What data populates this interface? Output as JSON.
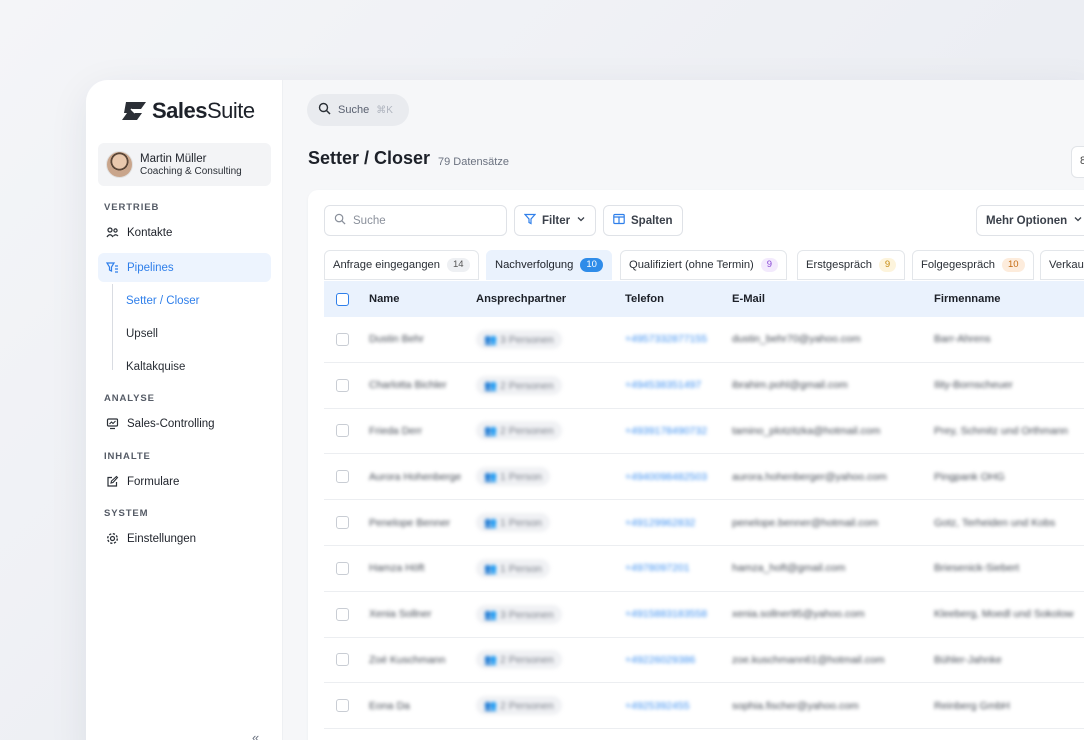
{
  "brand": {
    "bold": "Sales",
    "light": "Suite"
  },
  "user": {
    "name": "Martin Müller",
    "company": "Coaching & Consulting"
  },
  "nav": {
    "section_vertrieb": "VERTRIEB",
    "kontakte": "Kontakte",
    "pipelines": "Pipelines",
    "sub_items": [
      "Setter / Closer",
      "Upsell",
      "Kaltakquise"
    ],
    "section_analyse": "ANALYSE",
    "controlling": "Sales-Controlling",
    "section_inhalte": "INHALTE",
    "formulare": "Formulare",
    "section_system": "SYSTEM",
    "einstellungen": "Einstellungen",
    "collapse": "«"
  },
  "topbar": {
    "search_label": "Suche",
    "search_shortcut": "⌘K"
  },
  "page": {
    "title": "Setter / Closer",
    "count": "79 Datensätze",
    "corner_label": "8"
  },
  "toolbar": {
    "search_placeholder": "Suche",
    "filter": "Filter",
    "columns": "Spalten",
    "more": "Mehr Optionen"
  },
  "tabs": [
    {
      "label": "Anfrage eingegangen",
      "count": "14",
      "style": "gray"
    },
    {
      "label": "Nachverfolgung",
      "count": "10",
      "style": "blue"
    },
    {
      "label": "Qualifiziert (ohne Termin)",
      "count": "9",
      "style": "purple"
    },
    {
      "label": "Erstgespräch",
      "count": "9",
      "style": "yellow"
    },
    {
      "label": "Folgegespräch",
      "count": "10",
      "style": "orange"
    },
    {
      "label": "Verkau",
      "count": "",
      "style": "gray"
    }
  ],
  "table": {
    "headers": {
      "name": "Name",
      "contact": "Ansprechpartner",
      "phone": "Telefon",
      "email": "E-Mail",
      "company": "Firmenname"
    },
    "rows": [
      {
        "name": "Dustin Behr",
        "contact": "3 Personen",
        "phone": "+4957332877155",
        "email": "dustin_behr70@yahoo.com",
        "company": "Barr-Ahrens"
      },
      {
        "name": "Charlotta Bichler",
        "contact": "2 Personen",
        "phone": "+494538351497",
        "email": "ibrahim.pohl@gmail.com",
        "company": "Ility-Bornscheuer"
      },
      {
        "name": "Frieda Derr",
        "contact": "2 Personen",
        "phone": "+4939178490732",
        "email": "tamino_plotzitzka@hotmail.com",
        "company": "Prey, Schmitz und Orthmann"
      },
      {
        "name": "Aurora Hohenberge",
        "contact": "1 Person",
        "phone": "+4940098482503",
        "email": "aurora.hohenberger@yahoo.com",
        "company": "Pingpank OHG"
      },
      {
        "name": "Penelope Benner",
        "contact": "1 Person",
        "phone": "+49129962832",
        "email": "penelope.benner@hotmail.com",
        "company": "Gotz, Terheiden und Kobs"
      },
      {
        "name": "Hamza Höft",
        "contact": "1 Person",
        "phone": "+4978097201",
        "email": "hamza_hoft@gmail.com",
        "company": "Briesenick-Siebert"
      },
      {
        "name": "Xenia Sollner",
        "contact": "3 Personen",
        "phone": "+4915883183558",
        "email": "xenia.sollner95@yahoo.com",
        "company": "Kleeberg, Moedl und Sokolow"
      },
      {
        "name": "Zoé Kuschmann",
        "contact": "2 Personen",
        "phone": "+49226029386",
        "email": "zoe.kuschmann61@hotmail.com",
        "company": "Bühler-Jahnke"
      },
      {
        "name": "Eona Da",
        "contact": "2 Personen",
        "phone": "+4925392455",
        "email": "sophia.fischer@yahoo.com",
        "company": "Reinberg GmbH"
      }
    ]
  }
}
